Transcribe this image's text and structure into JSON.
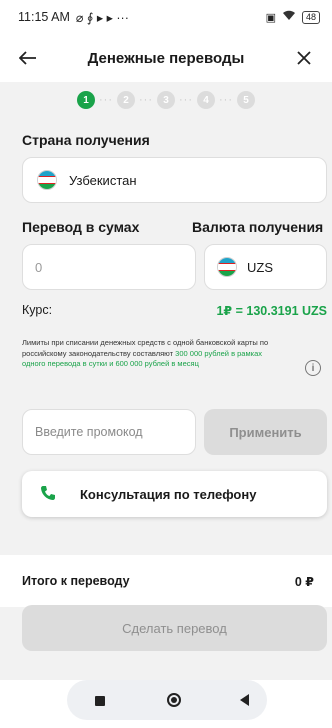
{
  "status_bar": {
    "time": "11:15 AM",
    "notif_icons": "⌀ ∮ ▸ ▸ ···",
    "battery": "48"
  },
  "header": {
    "title": "Денежные переводы"
  },
  "steps": [
    "1",
    "2",
    "3",
    "4",
    "5"
  ],
  "country": {
    "label": "Страна получения",
    "value": "Узбекистан"
  },
  "amount": {
    "label": "Перевод в сумах",
    "value": "0"
  },
  "currency": {
    "label": "Валюта получения",
    "value": "UZS"
  },
  "rate": {
    "label": "Курс:",
    "value": "1₽ = 130.3191 UZS"
  },
  "limits": {
    "part1": "Лимиты при списании денежных средств с одной банковской карты по российскому законодательству составляют ",
    "highlight": "300 000 рублей в рамках одного перевода в сутки и 600 000 рублей в месяц"
  },
  "promo": {
    "placeholder": "Введите промокод",
    "apply_label": "Применить"
  },
  "consult": {
    "label": "Консультация по телефону"
  },
  "total": {
    "label": "Итого к переводу",
    "value": "0 ₽"
  },
  "submit": {
    "label": "Сделать перевод"
  },
  "colors": {
    "accent": "#1aa34a",
    "disabled_bg": "#dcdcdc"
  },
  "icons": [
    "back-arrow-icon",
    "close-icon",
    "info-icon",
    "phone-icon",
    "uzbekistan-flag-icon"
  ]
}
